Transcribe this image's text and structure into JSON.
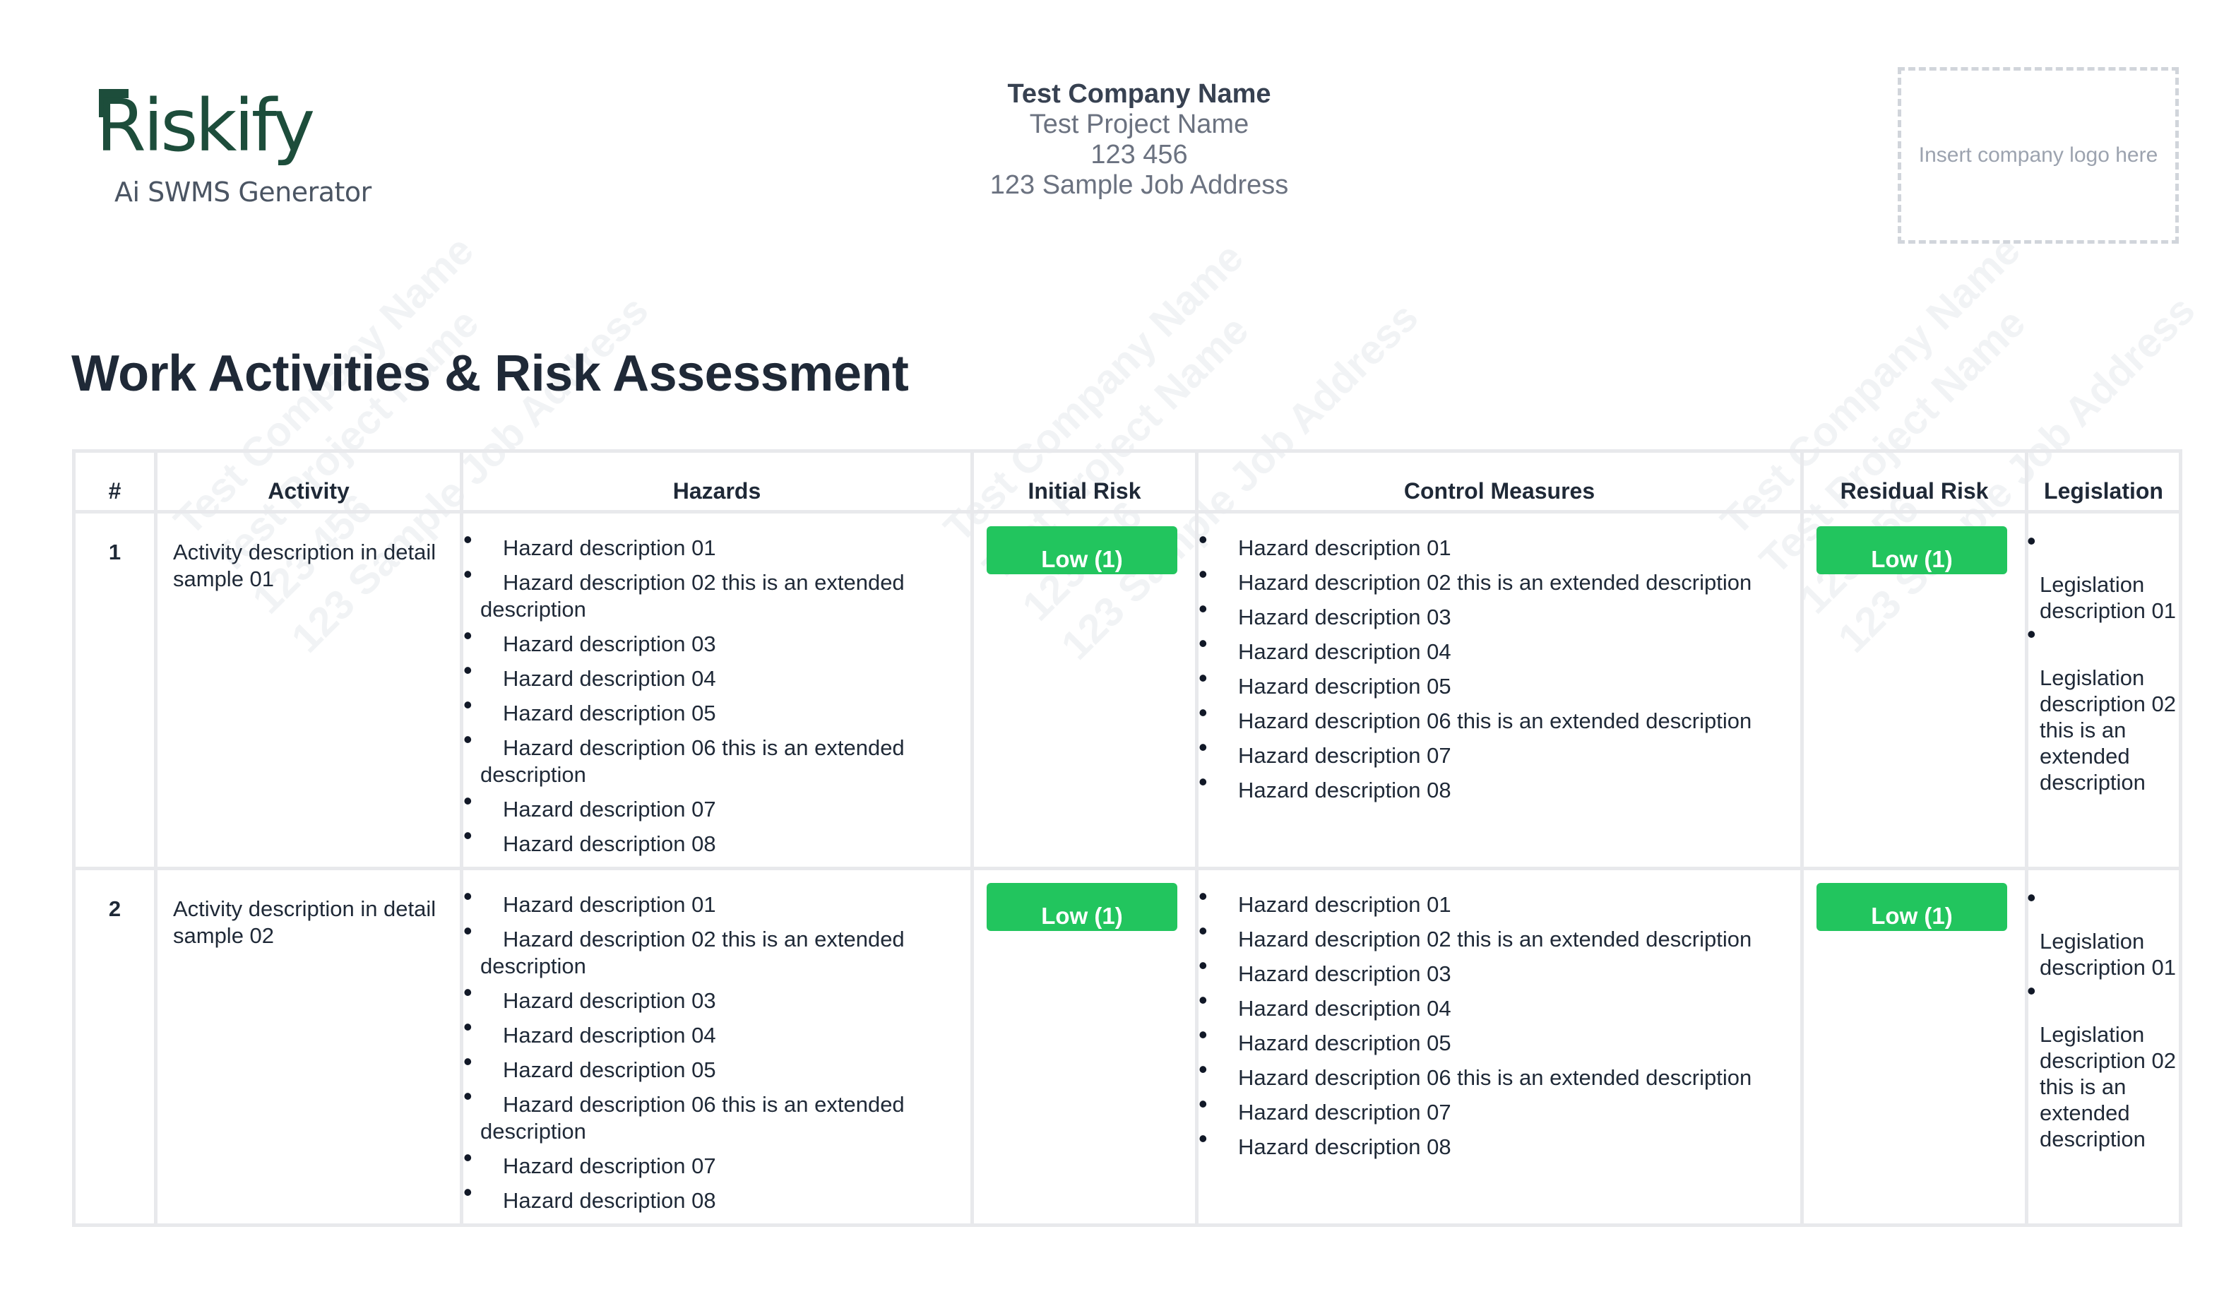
{
  "header": {
    "logo": {
      "word": "Riskify",
      "subtitle": "Ai SWMS Generator"
    },
    "company": {
      "name": "Test Company Name",
      "project": "Test Project Name",
      "number": "123 456",
      "address": "123 Sample Job Address"
    },
    "logo_placeholder": "Insert company logo here"
  },
  "page_title": "Work Activities & Risk Assessment",
  "table": {
    "headers": {
      "num": "#",
      "activity": "Activity",
      "hazards": "Hazards",
      "initial_risk": "Initial Risk",
      "control_measures": "Control Measures",
      "residual_risk": "Residual Risk",
      "legislation": "Legislation"
    },
    "rows": [
      {
        "num": "1",
        "activity": "Activity description in detail sample 01",
        "hazards": [
          "Hazard description 01",
          "Hazard description 02 this is an extended description",
          "Hazard description 03",
          "Hazard description 04",
          "Hazard description 05",
          "Hazard description 06 this is an extended description",
          "Hazard description 07",
          "Hazard description 08"
        ],
        "initial_risk": "Low (1)",
        "controls": [
          "Hazard description 01",
          "Hazard description 02 this is an extended description",
          "Hazard description 03",
          "Hazard description 04",
          "Hazard description 05",
          "Hazard description 06 this is an extended description",
          "Hazard description 07",
          "Hazard description 08"
        ],
        "residual_risk": "Low (1)",
        "legislation": [
          "Legislation description 01",
          "Legislation description 02 this is an extended description"
        ]
      },
      {
        "num": "2",
        "activity": "Activity description in detail sample 02",
        "hazards": [
          "Hazard description 01",
          "Hazard description 02 this is an extended description",
          "Hazard description 03",
          "Hazard description 04",
          "Hazard description 05",
          "Hazard description 06 this is an extended description",
          "Hazard description 07",
          "Hazard description 08"
        ],
        "initial_risk": "Low (1)",
        "controls": [
          "Hazard description 01",
          "Hazard description 02 this is an extended description",
          "Hazard description 03",
          "Hazard description 04",
          "Hazard description 05",
          "Hazard description 06 this is an extended description",
          "Hazard description 07",
          "Hazard description 08"
        ],
        "residual_risk": "Low (1)",
        "legislation": [
          "Legislation description 01",
          "Legislation description 02 this is an extended description"
        ]
      }
    ]
  },
  "colors": {
    "brand": "#1d4d3b",
    "risk_low": "#22c55e",
    "border": "#e8e9ec",
    "watermark": "#f1f3f5"
  }
}
